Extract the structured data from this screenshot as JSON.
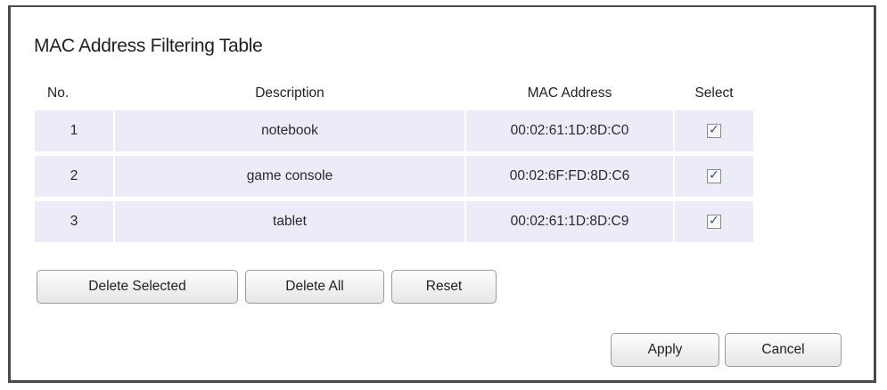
{
  "section": {
    "title": "MAC Address Filtering Table"
  },
  "table": {
    "headers": {
      "no": "No.",
      "description": "Description",
      "mac": "MAC Address",
      "select": "Select"
    },
    "rows": [
      {
        "no": "1",
        "description": "notebook",
        "mac": "00:02:61:1D:8D:C0",
        "selected": true
      },
      {
        "no": "2",
        "description": "game console",
        "mac": "00:02:6F:FD:8D:C6",
        "selected": true
      },
      {
        "no": "3",
        "description": "tablet",
        "mac": "00:02:61:1D:8D:C9",
        "selected": true
      }
    ]
  },
  "buttons": {
    "delete_selected": "Delete Selected",
    "delete_all": "Delete All",
    "reset": "Reset",
    "apply": "Apply",
    "cancel": "Cancel"
  },
  "colors": {
    "row_background": "#ecebf8",
    "panel_border": "#4a4a4a"
  }
}
